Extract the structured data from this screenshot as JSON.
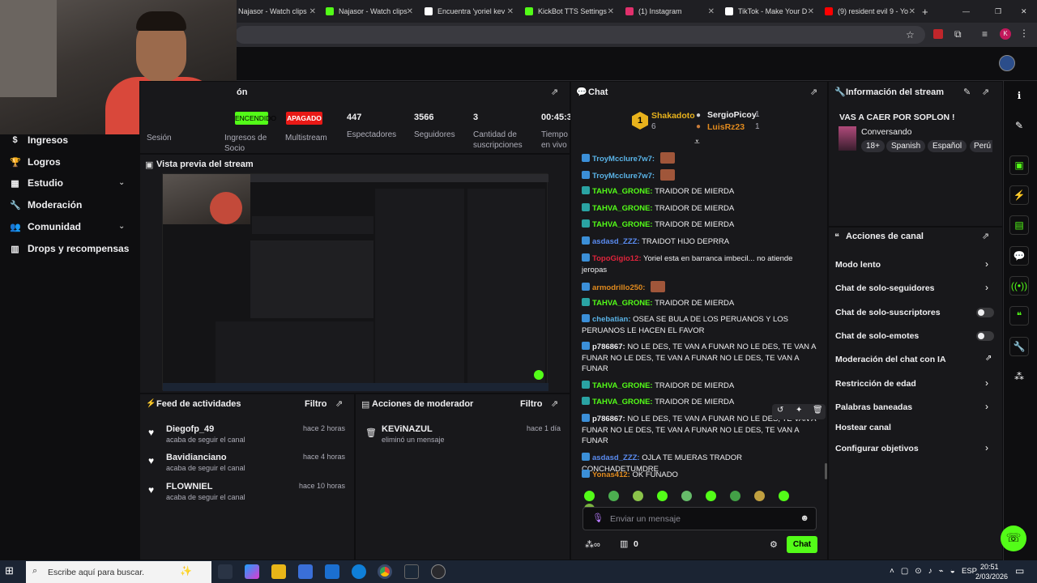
{
  "browser": {
    "tabs": [
      {
        "label": "Najasor - Watch clips",
        "color": "#9146ff"
      },
      {
        "label": "Najasor - Watch clips",
        "color": "#53fc18"
      },
      {
        "label": "Encuentra 'yoriel kev",
        "color": "#000000"
      },
      {
        "label": "KickBot TTS Settings",
        "color": "#53fc18"
      },
      {
        "label": "(1) Instagram",
        "color": "#e1306c"
      },
      {
        "label": "TikTok - Make Your D",
        "color": "#111111"
      },
      {
        "label": "(9) resident evil 9 - Yo",
        "color": "#ff0000"
      }
    ],
    "new_tab": "+",
    "controls": {
      "minimize": "—",
      "maximize": "❐",
      "close": "✕"
    }
  },
  "sidebar": {
    "items": [
      {
        "label": "Ingresos",
        "icon": "dollar-icon"
      },
      {
        "label": "Logros",
        "icon": "trophy-icon"
      },
      {
        "label": "Estudio",
        "icon": "grid-icon",
        "expand": "⌄"
      },
      {
        "label": "Moderación",
        "icon": "wrench-icon"
      },
      {
        "label": "Comunidad",
        "icon": "users-icon",
        "expand": "⌄"
      },
      {
        "label": "Drops y recompensas",
        "icon": "gift-icon"
      }
    ]
  },
  "session": {
    "title_fragment": "ón",
    "labels": [
      "Sesión",
      "Ingresos de Socio",
      "Multistream",
      "Espectadores",
      "Seguidores",
      "Cantidad de suscripciones",
      "Tiempo en vivo"
    ],
    "badge_on": "ENCENDIDO",
    "badge_off": "APAGADO",
    "viewers": "447",
    "followers": "3566",
    "subs": "3",
    "time": "00:45:3"
  },
  "preview": {
    "title": "Vista previa del stream"
  },
  "feed": {
    "title": "Feed de actividades",
    "filter": "Filtro",
    "items": [
      {
        "name": "Diegofp_49",
        "action": "acaba de seguir el canal",
        "time": "hace 2 horas"
      },
      {
        "name": "Bavidianciano",
        "action": "acaba de seguir el canal",
        "time": "hace 4 horas"
      },
      {
        "name": "FLOWNIEL",
        "action": "acaba de seguir el canal",
        "time": "hace 10 horas"
      }
    ]
  },
  "modactions": {
    "title": "Acciones de moderador",
    "filter": "Filtro",
    "items": [
      {
        "name": "KEViNAZUL",
        "action": "eliminó un mensaje",
        "time": "hace 1 día"
      }
    ]
  },
  "chat": {
    "title": "Chat",
    "leaderboard": {
      "first": {
        "rank": "1",
        "name": "Shakadoto",
        "count": "6"
      },
      "second": {
        "name": "SergioPicoy",
        "count": "1"
      },
      "third": {
        "name": "LuisRz23",
        "count": "1"
      }
    },
    "messages": [
      {
        "user": "TroyMcclure7w7:",
        "text": "",
        "color": "#5ab4e8"
      },
      {
        "user": "TroyMcclure7w7:",
        "text": "",
        "color": "#5ab4e8"
      },
      {
        "user": "TAHVA_GRONE:",
        "text": "TRAIDOR DE MIERDA",
        "color": "#53fc18"
      },
      {
        "user": "TAHVA_GRONE:",
        "text": "TRAIDOR DE MIERDA",
        "color": "#53fc18"
      },
      {
        "user": "TAHVA_GRONE:",
        "text": "TRAIDOR DE MIERDA",
        "color": "#53fc18"
      },
      {
        "user": "asdasd_ZZZ:",
        "text": "TRAIDOT HIJO DEPRRA",
        "color": "#5a8bf0"
      },
      {
        "user": "TopoGigio12:",
        "text": "Yoriel esta en barranca imbecil... no atiende jeropas",
        "color": "#e0243c"
      },
      {
        "user": "armodrillo250:",
        "text": "",
        "color": "#e08a1e"
      },
      {
        "user": "TAHVA_GRONE:",
        "text": "TRAIDOR DE MIERDA",
        "color": "#53fc18"
      },
      {
        "user": "chebatian:",
        "text": "OSEA SE BULA DE LOS PERUANOS Y LOS PERUANOS LE HACEN EL FAVOR",
        "color": "#5ab4e8"
      },
      {
        "user": "p786867:",
        "text": "NO LE DES, TE VAN A FUNAR NO LE DES, TE VAN A FUNAR NO LE DES, TE VAN A FUNAR NO LE DES, TE VAN A FUNAR",
        "color": "#efeff1"
      },
      {
        "user": "TAHVA_GRONE:",
        "text": "TRAIDOR DE MIERDA",
        "color": "#53fc18"
      },
      {
        "user": "TAHVA_GRONE:",
        "text": "TRAIDOR DE MIERDA",
        "color": "#53fc18"
      },
      {
        "user": "p786867:",
        "text": "NO LE DES, TE VAN A FUNAR NO LE DES, TE VAN A FUNAR NO LE DES, TE VAN A FUNAR NO LE DES, TE VAN A FUNAR",
        "color": "#efeff1"
      },
      {
        "user": "asdasd_ZZZ:",
        "text": "OJLA TE MUERAS TRADOR CONCHADETUMDRE",
        "color": "#5a8bf0"
      },
      {
        "user": "Yonas412:",
        "text": "OK FUNADO",
        "color": "#e08a1e"
      }
    ],
    "input_placeholder": "Enviar un mensaje",
    "points": "0",
    "send": "Chat"
  },
  "streaminfo": {
    "title": "Información del stream",
    "stream_title": "VAS A CAER POR SOPLON !",
    "category": "Conversando",
    "tags": [
      "18+",
      "Spanish",
      "Español",
      "Perú"
    ]
  },
  "channel_actions": {
    "title": "Acciones de canal",
    "items": [
      {
        "label": "Modo lento",
        "control": "chevron"
      },
      {
        "label": "Chat de solo-seguidores",
        "control": "chevron"
      },
      {
        "label": "Chat de solo-suscriptores",
        "control": "toggle"
      },
      {
        "label": "Chat de solo-emotes",
        "control": "toggle"
      },
      {
        "label": "Moderación del chat con IA",
        "control": "external"
      },
      {
        "label": "Restricción de edad",
        "control": "chevron"
      },
      {
        "label": "Palabras baneadas",
        "control": "chevron"
      },
      {
        "label": "Hostear canal",
        "control": "none"
      },
      {
        "label": "Configurar objetivos",
        "control": "chevron"
      }
    ]
  },
  "taskbar": {
    "search": "Escribe aquí para buscar.",
    "lang": "ESP",
    "time": "20:51",
    "date": "2/03/2026"
  },
  "colors": {
    "accent": "#53fc18",
    "bg": "#0e0e10",
    "panel": "#18181b",
    "off": "#e91916"
  }
}
